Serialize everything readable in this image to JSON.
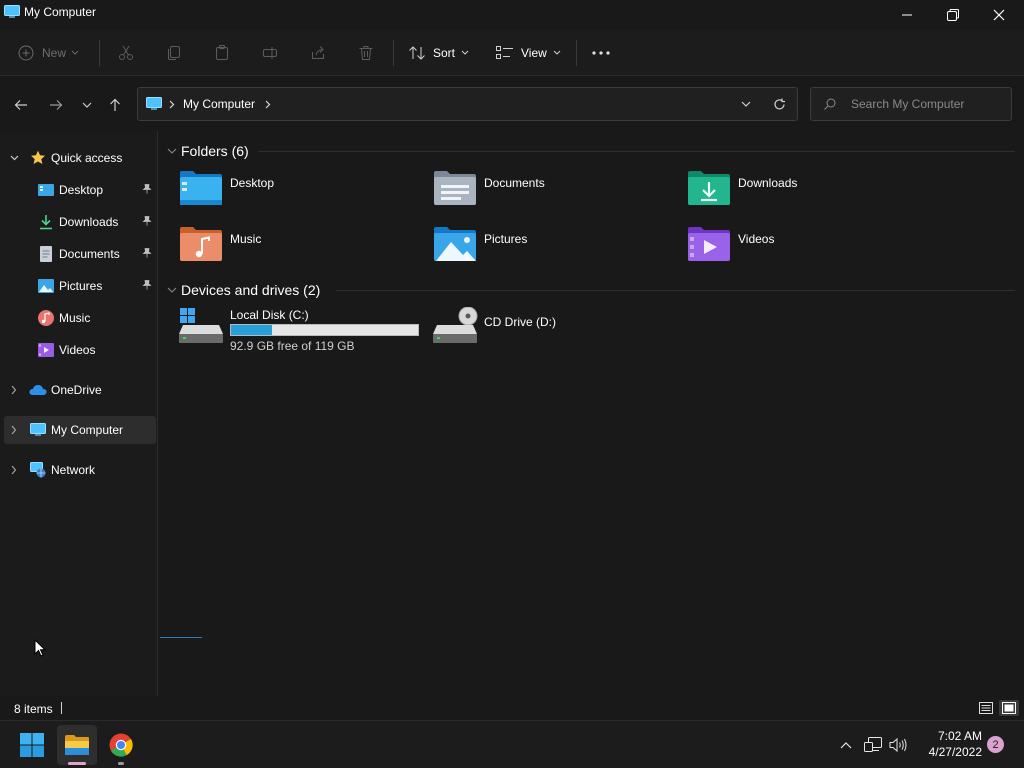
{
  "window": {
    "title": "My Computer",
    "minimize_icon": "minimize-icon",
    "maximize_icon": "restore-icon",
    "close_icon": "close-icon"
  },
  "toolbar": {
    "new_label": "New",
    "sort_label": "Sort",
    "view_label": "View",
    "icons": [
      "plus-icon",
      "cut-icon",
      "copy-icon",
      "paste-icon",
      "rename-icon",
      "share-icon",
      "delete-icon",
      "sort-icon",
      "view-icon",
      "more-icon"
    ]
  },
  "navigation": {
    "breadcrumb": "My Computer",
    "search_placeholder": "Search My Computer"
  },
  "sidebar": {
    "items": [
      {
        "label": "Quick access",
        "icon": "star-icon"
      },
      {
        "label": "Desktop",
        "icon": "desktop-icon",
        "pinned": true
      },
      {
        "label": "Downloads",
        "icon": "downloads-icon",
        "pinned": true
      },
      {
        "label": "Documents",
        "icon": "documents-icon",
        "pinned": true
      },
      {
        "label": "Pictures",
        "icon": "pictures-icon",
        "pinned": true
      },
      {
        "label": "Music",
        "icon": "music-icon"
      },
      {
        "label": "Videos",
        "icon": "videos-icon"
      },
      {
        "label": "OneDrive",
        "icon": "cloud-icon"
      },
      {
        "label": "My Computer",
        "icon": "computer-icon",
        "selected": true
      },
      {
        "label": "Network",
        "icon": "network-icon"
      }
    ]
  },
  "content": {
    "folders_header": "Folders (6)",
    "folders": [
      {
        "label": "Desktop",
        "icon": "desktop-folder-icon"
      },
      {
        "label": "Documents",
        "icon": "documents-folder-icon"
      },
      {
        "label": "Downloads",
        "icon": "downloads-folder-icon"
      },
      {
        "label": "Music",
        "icon": "music-folder-icon"
      },
      {
        "label": "Pictures",
        "icon": "pictures-folder-icon"
      },
      {
        "label": "Videos",
        "icon": "videos-folder-icon"
      }
    ],
    "drives_header": "Devices and drives (2)",
    "drives": [
      {
        "label": "Local Disk (C:)",
        "free_text": "92.9 GB free of 119 GB",
        "used_fraction": 0.22,
        "icon": "local-disk-icon"
      },
      {
        "label": "CD Drive (D:)",
        "icon": "cd-drive-icon"
      }
    ]
  },
  "status": {
    "item_count": "8 items",
    "view_icons": [
      "details-view-icon",
      "tiles-view-icon"
    ]
  },
  "taskbar": {
    "time": "7:02 AM",
    "date": "4/27/2022",
    "notification_count": "2",
    "apps": [
      "start-icon",
      "file-explorer-icon",
      "chrome-icon"
    ],
    "tray_icons": [
      "chevron-up-icon",
      "network-tray-icon",
      "volume-icon"
    ]
  },
  "colors": {
    "accent": "#4cc2ff",
    "progress_fill": "#26a0da",
    "progress_track": "#e6e6e6",
    "background": "#191919"
  }
}
